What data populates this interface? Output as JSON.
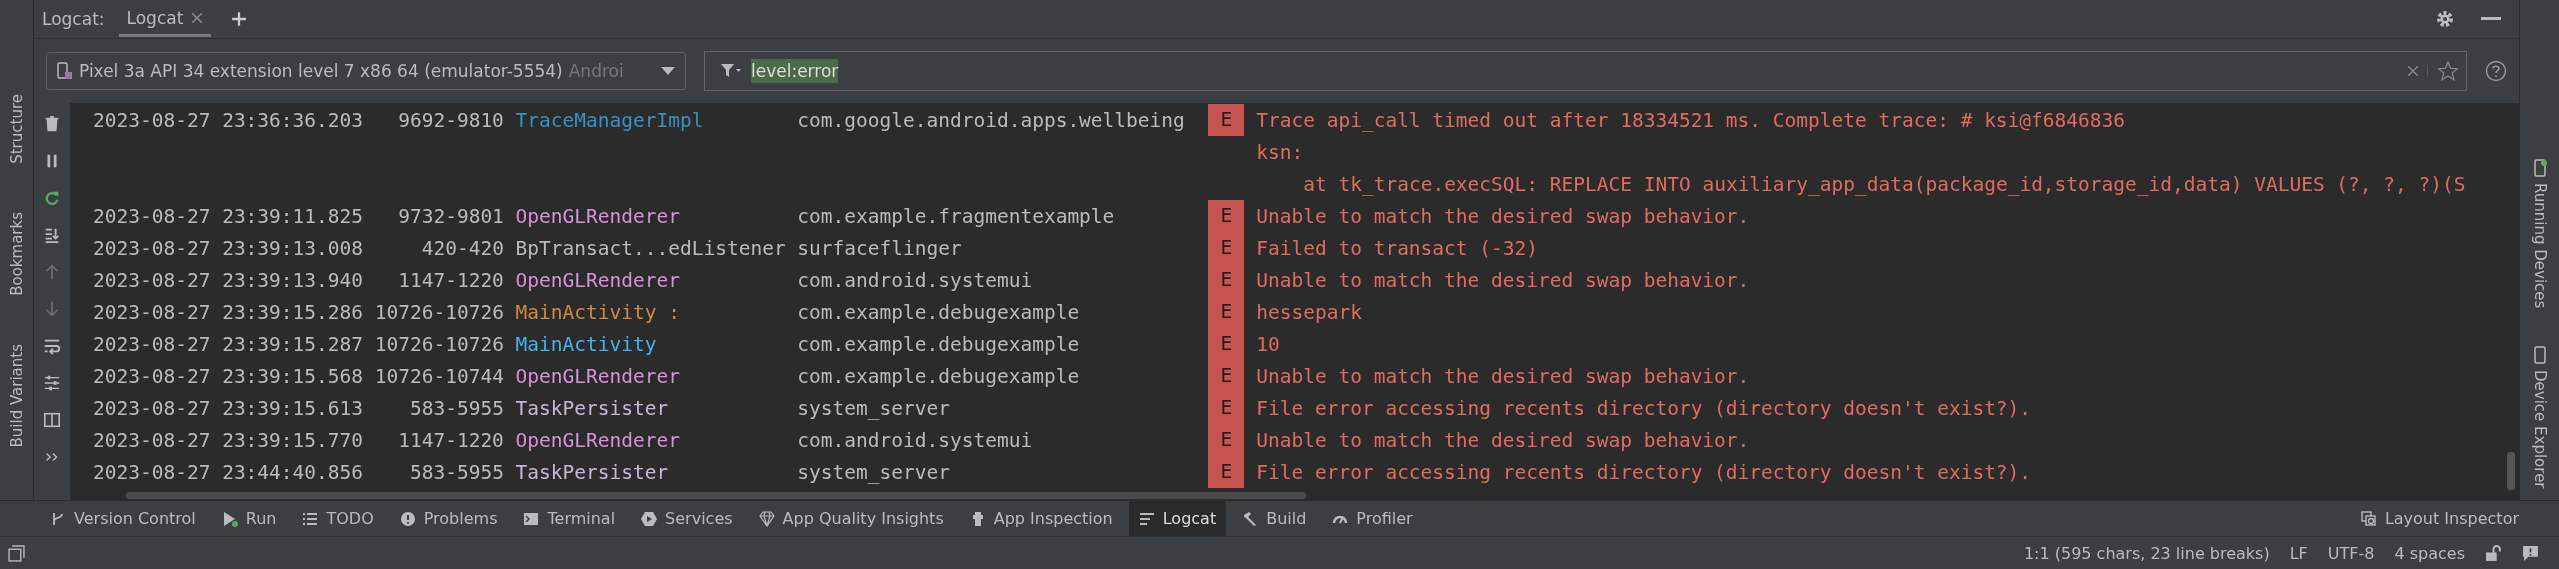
{
  "left_stripe": [
    {
      "label": "Structure"
    },
    {
      "label": "Bookmarks"
    },
    {
      "label": "Build Variants"
    }
  ],
  "right_stripe": [
    {
      "label": "Running Devices"
    },
    {
      "label": "Device Explorer"
    }
  ],
  "header": {
    "title": "Logcat:",
    "tabs": [
      {
        "label": "Logcat",
        "selected": true
      }
    ]
  },
  "device_selector": {
    "value": "Pixel 3a API 34 extension level 7 x86 64 (emulator-5554)",
    "suffix": "Androi"
  },
  "filter": {
    "value": "level:error"
  },
  "log_toolbar": [
    {
      "kind": "trash",
      "disabled": false
    },
    {
      "kind": "pause",
      "disabled": false
    },
    {
      "kind": "restart",
      "disabled": false
    },
    {
      "kind": "scroll-end",
      "disabled": false
    },
    {
      "kind": "up",
      "disabled": true
    },
    {
      "kind": "down",
      "disabled": true
    },
    {
      "kind": "wrap",
      "disabled": false
    },
    {
      "kind": "settings",
      "disabled": false
    },
    {
      "kind": "split",
      "disabled": false
    },
    {
      "kind": "more",
      "disabled": false
    }
  ],
  "log": [
    {
      "timestamp": "2023-08-27 23:36:36.203",
      "pid": "9692-9810",
      "tag": "TraceManagerImpl",
      "color": "#3592c4",
      "package": "com.google.android.apps.wellbeing",
      "level": "E",
      "message": "Trace api_call timed out after 18334521 ms. Complete trace: # ksi@f6846836",
      "continuation": [
        {
          "kind": "plain",
          "text": "ksn:"
        },
        {
          "kind": "stack",
          "text": "at tk_trace.execSQL: REPLACE INTO auxiliary_app_data(package_id,storage_id,data) VALUES (?, ?, ?)(S"
        }
      ]
    },
    {
      "timestamp": "2023-08-27 23:39:11.825",
      "pid": "9732-9801",
      "tag": "OpenGLRenderer",
      "color": "#d592d6",
      "package": "com.example.fragmentexample",
      "level": "E",
      "message": "Unable to match the desired swap behavior."
    },
    {
      "timestamp": "2023-08-27 23:39:13.008",
      "pid": "420-420",
      "tag": "BpTransact...edListener",
      "color": "#bbbbbb",
      "package": "surfaceflinger",
      "level": "E",
      "message": "Failed to transact (-32)"
    },
    {
      "timestamp": "2023-08-27 23:39:13.940",
      "pid": "1147-1220",
      "tag": "OpenGLRenderer",
      "color": "#d592d6",
      "package": "com.android.systemui",
      "level": "E",
      "message": "Unable to match the desired swap behavior."
    },
    {
      "timestamp": "2023-08-27 23:39:15.286",
      "pid": "10726-10726",
      "tag": "MainActivity :",
      "color": "#d0893f",
      "package": "com.example.debugexample",
      "level": "E",
      "message": "hessepark"
    },
    {
      "timestamp": "2023-08-27 23:39:15.287",
      "pid": "10726-10726",
      "tag": "MainActivity",
      "color": "#3fb5ec",
      "package": "com.example.debugexample",
      "level": "E",
      "message": "10"
    },
    {
      "timestamp": "2023-08-27 23:39:15.568",
      "pid": "10726-10744",
      "tag": "OpenGLRenderer",
      "color": "#d592d6",
      "package": "com.example.debugexample",
      "level": "E",
      "message": "Unable to match the desired swap behavior."
    },
    {
      "timestamp": "2023-08-27 23:39:15.613",
      "pid": "583-5955",
      "tag": "TaskPersister",
      "color": "#c9b6d9",
      "package": "system_server",
      "level": "E",
      "message": "File error accessing recents directory (directory doesn't exist?)."
    },
    {
      "timestamp": "2023-08-27 23:39:15.770",
      "pid": "1147-1220",
      "tag": "OpenGLRenderer",
      "color": "#d592d6",
      "package": "com.android.systemui",
      "level": "E",
      "message": "Unable to match the desired swap behavior."
    },
    {
      "timestamp": "2023-08-27 23:44:40.856",
      "pid": "583-5955",
      "tag": "TaskPersister",
      "color": "#c9b6d9",
      "package": "system_server",
      "level": "E",
      "message": "File error accessing recents directory (directory doesn't exist?)."
    }
  ],
  "tool_windows": [
    {
      "kind": "vcs",
      "label": "Version Control",
      "selected": false
    },
    {
      "kind": "run",
      "label": "Run",
      "selected": false
    },
    {
      "kind": "todo",
      "label": "TODO",
      "selected": false
    },
    {
      "kind": "problems",
      "label": "Problems",
      "selected": false
    },
    {
      "kind": "terminal",
      "label": "Terminal",
      "selected": false
    },
    {
      "kind": "services",
      "label": "Services",
      "selected": false
    },
    {
      "kind": "gem",
      "label": "App Quality Insights",
      "selected": false
    },
    {
      "kind": "inspect",
      "label": "App Inspection",
      "selected": false
    },
    {
      "kind": "logcat",
      "label": "Logcat",
      "selected": true
    },
    {
      "kind": "build",
      "label": "Build",
      "selected": false
    },
    {
      "kind": "profiler",
      "label": "Profiler",
      "selected": false
    }
  ],
  "tool_windows_right": [
    {
      "kind": "layout",
      "label": "Layout Inspector",
      "selected": false
    }
  ],
  "status_bar": {
    "position": "1:1 (595 chars, 23 line breaks)",
    "line_separator": "LF",
    "encoding": "UTF-8",
    "indent": "4 spaces"
  }
}
